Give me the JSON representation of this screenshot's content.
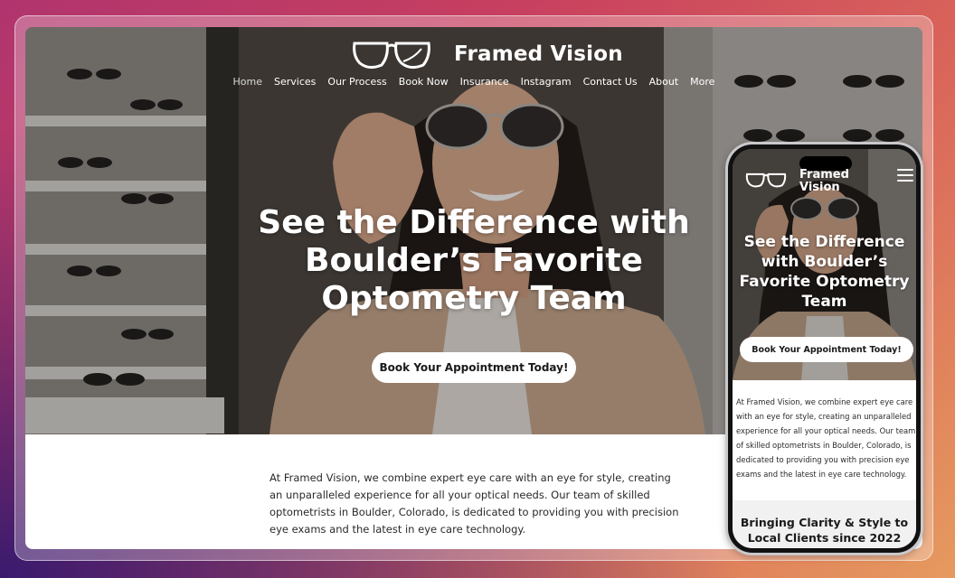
{
  "site": {
    "brand": "Framed Vision",
    "nav": [
      "Home",
      "Services",
      "Our Process",
      "Book Now",
      "Insurance",
      "Instagram",
      "Contact Us",
      "About",
      "More"
    ],
    "active_nav": "Home",
    "hero_title": "See the Difference with Boulder’s Favorite Optometry Team",
    "cta_label": "Book Your Appointment Today!",
    "intro": "At Framed Vision, we combine expert eye care with an eye for style, creating an unparalleled experience for all your optical needs. Our team of skilled optometrists in Boulder, Colorado, is dedicated to providing you with precision eye exams and the latest in eye care technology."
  },
  "mobile": {
    "brand": "Framed Vision",
    "hero_title": "See the Difference with Boulder’s Favorite Optometry Team",
    "cta_label": "Book Your Appointment Today!",
    "intro": "At Framed Vision, we combine expert eye care with an eye for style, creating an unparalleled experience for all your optical needs. Our team of skilled optometrists in Boulder, Colorado, is dedicated to providing you with precision eye exams and the latest in eye care technology.",
    "section_title": "Bringing Clarity & Style to Local Clients since 2022"
  },
  "icons": {
    "logo": "glasses-logo-icon",
    "menu": "hamburger-menu-icon"
  },
  "colors": {
    "accent_bg": "#ffffff",
    "text_dark": "#1a1a1a"
  }
}
